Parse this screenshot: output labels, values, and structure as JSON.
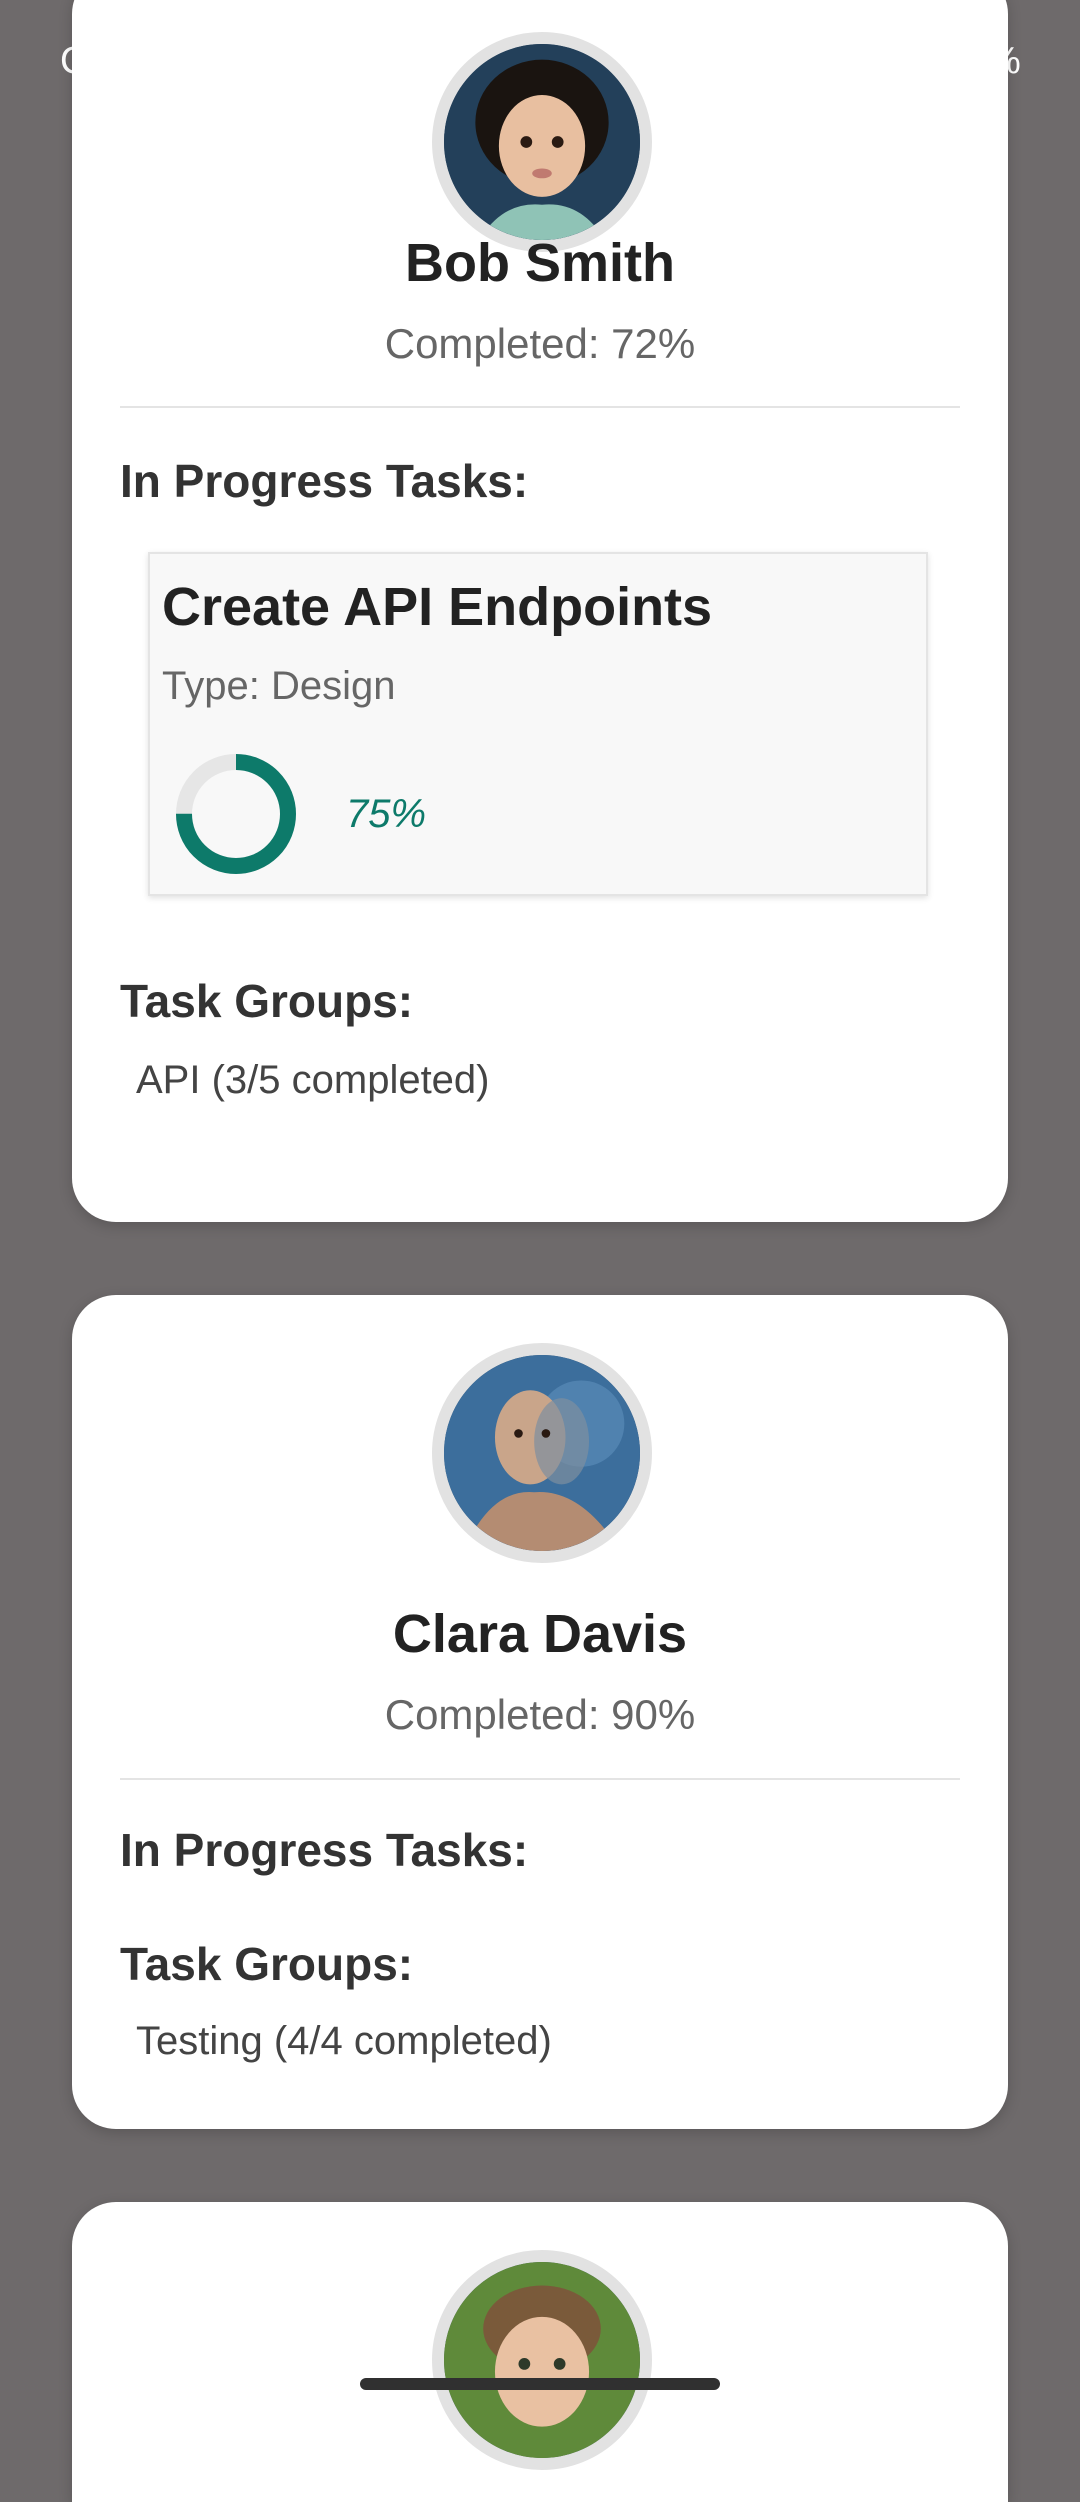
{
  "status_bar": {
    "left_text": "C",
    "right_text": "%"
  },
  "members": [
    {
      "name": "Bob Smith",
      "completed_label": "Completed: 72%",
      "in_progress_heading": "In Progress Tasks:",
      "task": {
        "title": "Create API Endpoints",
        "type_label": "Type: Design",
        "progress": 0.75,
        "progress_label": "75%",
        "progress_color": "#0d7a6a"
      },
      "groups_heading": "Task Groups:",
      "groups": [
        "API (3/5 completed)"
      ]
    },
    {
      "name": "Clara Davis",
      "completed_label": "Completed: 90%",
      "in_progress_heading": "In Progress Tasks:",
      "groups_heading": "Task Groups:",
      "groups": [
        "Testing (4/4 completed)"
      ]
    }
  ]
}
